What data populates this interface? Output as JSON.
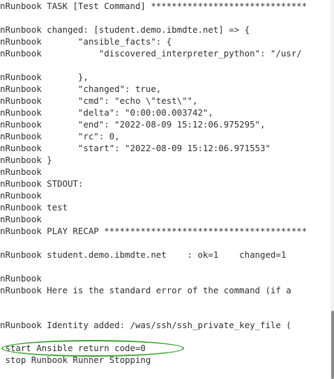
{
  "log": {
    "lines": [
      "nRunbook TASK [Test Command] ******************************",
      "",
      "nRunbook changed: [student.demo.ibmdte.net] => {",
      "nRunbook       \"ansible_facts\": {",
      "nRunbook           \"discovered_interpreter_python\": \"/usr/",
      "",
      "nRunbook       },",
      "nRunbook       \"changed\": true,",
      "nRunbook       \"cmd\": \"echo \\\"test\\\"\",",
      "nRunbook       \"delta\": \"0:00:00.003742\",",
      "nRunbook       \"end\": \"2022-08-09 15:12:06.975295\",",
      "nRunbook       \"rc\": 0,",
      "nRunbook       \"start\": \"2022-08-09 15:12:06.971553\"",
      "nRunbook }",
      "nRunbook",
      "nRunbook STDOUT:",
      "nRunbook",
      "nRunbook test",
      "nRunbook",
      "nRunbook PLAY RECAP ***************************************",
      "",
      "nRunbook student.demo.ibmdte.net    : ok=1    changed=1",
      "",
      "nRunbook",
      "nRunbook Here is the standard error of the command (if a",
      "",
      "",
      "nRunbook Identity added: /was/ssh/ssh_private_key_file (",
      "",
      " start Ansible return code=0",
      " stop Runbook Runner Stopping"
    ],
    "highlighted_line": " start Ansible return code=0"
  },
  "colors": {
    "text": "#2e2e2e",
    "background": "#ffffff",
    "highlight": "#3aa32e",
    "scroll_thumb": "#8a8a8a"
  }
}
